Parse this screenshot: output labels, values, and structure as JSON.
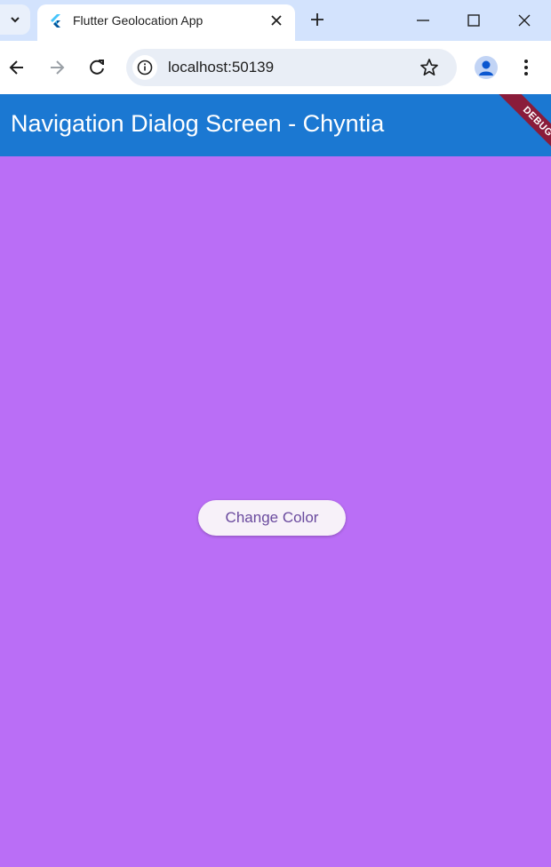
{
  "browser": {
    "tab_title": "Flutter Geolocation App",
    "url": "localhost:50139"
  },
  "icons": {
    "tab_search": "chevron-down-icon",
    "favicon": "flutter-icon",
    "tab_close": "close-icon",
    "new_tab": "plus-icon",
    "back": "arrow-left-icon",
    "forward": "arrow-right-icon",
    "reload": "reload-icon",
    "site_info": "info-icon",
    "bookmark": "star-icon",
    "profile": "person-icon",
    "menu": "more-vertical-icon"
  },
  "app": {
    "title": "Navigation Dialog Screen - Chyntia",
    "debug_banner": "DEBUG",
    "button_label": "Change Color"
  },
  "colors": {
    "appbar": "#1b78d2",
    "background": "#ba6ef6",
    "button": "#f7f1f9",
    "button_text": "#6a4a9e"
  }
}
